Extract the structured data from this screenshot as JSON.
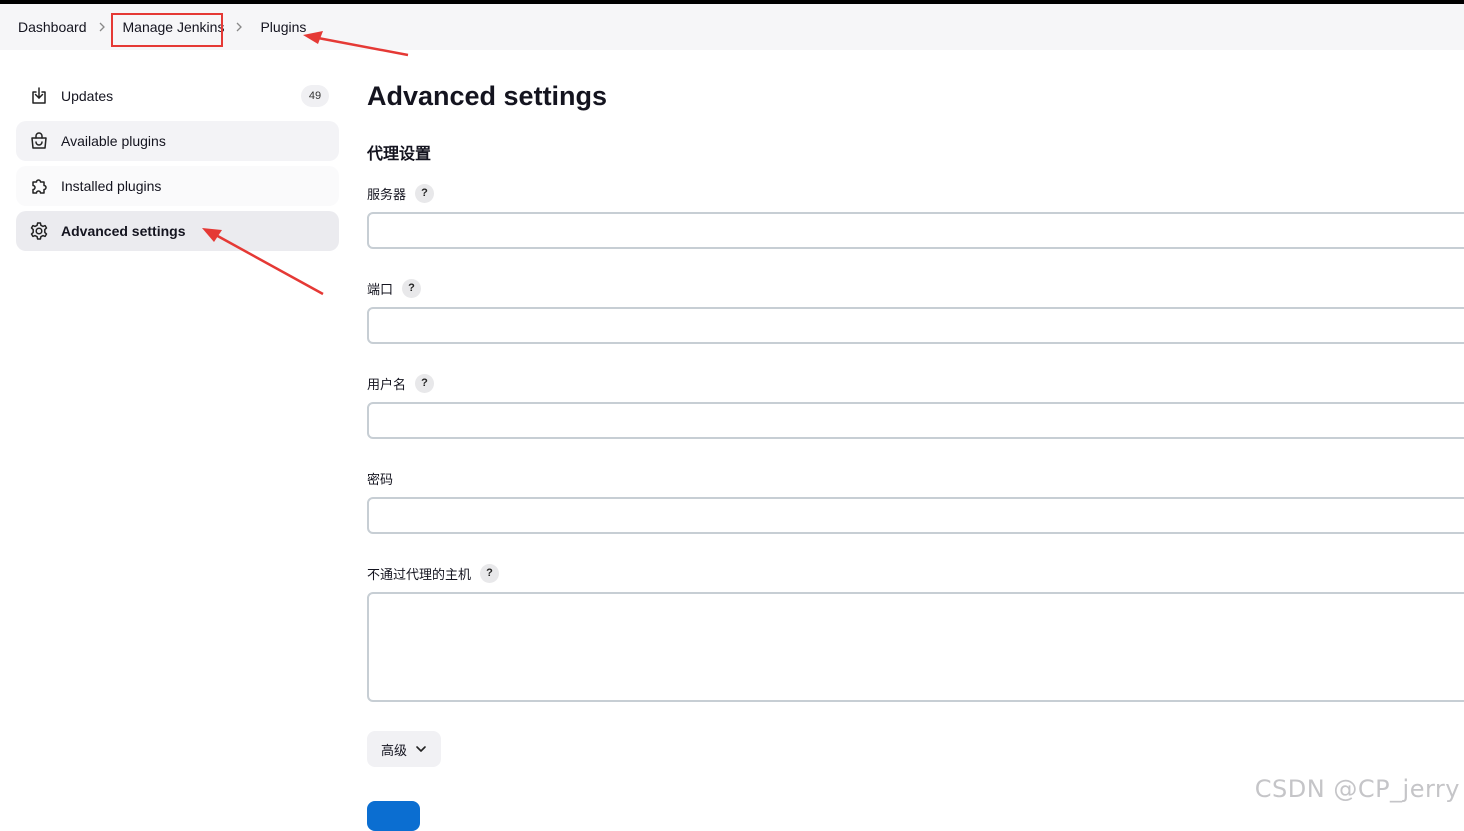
{
  "breadcrumb": {
    "items": [
      "Dashboard",
      "Manage Jenkins",
      "Plugins"
    ]
  },
  "sidebar": {
    "items": [
      {
        "label": "Updates",
        "icon": "download-icon",
        "badge": "49"
      },
      {
        "label": "Available plugins",
        "icon": "shopping-bag-icon"
      },
      {
        "label": "Installed plugins",
        "icon": "puzzle-icon"
      },
      {
        "label": "Advanced settings",
        "icon": "gear-icon"
      }
    ]
  },
  "main": {
    "title": "Advanced settings",
    "section_title": "代理设置",
    "fields": {
      "server": {
        "label": "服务器",
        "value": ""
      },
      "port": {
        "label": "端口",
        "value": ""
      },
      "username": {
        "label": "用户名",
        "value": ""
      },
      "password": {
        "label": "密码",
        "value": ""
      },
      "no_proxy": {
        "label": "不通过代理的主机",
        "value": ""
      }
    },
    "help_glyph": "?",
    "advanced_button": "高级"
  },
  "watermark": "CSDN @CP_jerry",
  "colors": {
    "annotation_red": "#e53935",
    "primary_blue": "#0b6ed1"
  }
}
